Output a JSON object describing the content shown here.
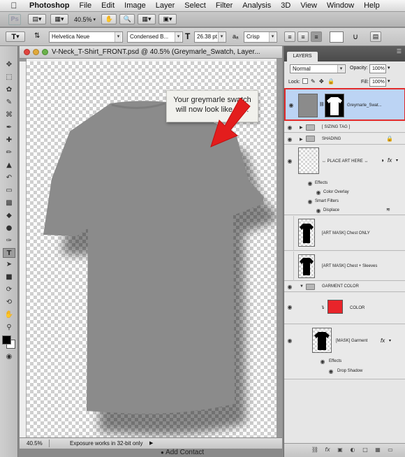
{
  "menubar": {
    "app": "Photoshop",
    "items": [
      "File",
      "Edit",
      "Image",
      "Layer",
      "Select",
      "Filter",
      "Analysis",
      "3D",
      "View",
      "Window",
      "Help"
    ]
  },
  "appbar": {
    "logo": "Ps",
    "zoom": "40.5%"
  },
  "options": {
    "tool_glyph": "T",
    "font_family": "Helvetica Neue",
    "font_style": "Condensed B...",
    "font_size": "26.38 pt",
    "aa_label": "aₐ",
    "antialias": "Crisp"
  },
  "document": {
    "title": "V-Neck_T-Shirt_FRONT.psd @ 40.5% (Greymarle_Swatch, Layer...",
    "zoom": "40.5%",
    "status": "Exposure works in 32-bit only",
    "callout_line1": "Your greymarle swatch",
    "callout_line2": "will now look like this."
  },
  "colors": {
    "selection_border": "#e22b2b",
    "selection_bg": "#bcd4f4",
    "arrow_red": "#e31d1d",
    "swatch_red": "#e9242a",
    "shirt_grey": "#8b8b8b"
  },
  "layers_panel": {
    "tab": "LAYERS",
    "blend_mode": "Normal",
    "opacity_label": "Opacity:",
    "opacity": "100%",
    "lock_label": "Lock:",
    "fill_label": "Fill:",
    "fill": "100%",
    "rows": {
      "greymarle": "Greymarle_Swat...",
      "sizing_tag": "[ SIZING TAG ]",
      "shading": "SHADING",
      "place_art": "↔ PLACE ART HERE ↔",
      "effects": "Effects",
      "color_overlay": "Color Overlay",
      "smart_filters": "Smart Filters",
      "displace": "Displace",
      "mask_chest": "[ART MASK] Chest ONLY",
      "mask_chest_sleeves": "[ART MASK] Chest + Sleeves",
      "garment_color": "GARMENT COLOR",
      "color": "COLOR",
      "mask_garment": "[MASK] Garment",
      "effects2": "Effects",
      "drop_shadow": "Drop Shadow"
    },
    "fx": "fx"
  },
  "bottom": {
    "text": "Add Contact"
  }
}
